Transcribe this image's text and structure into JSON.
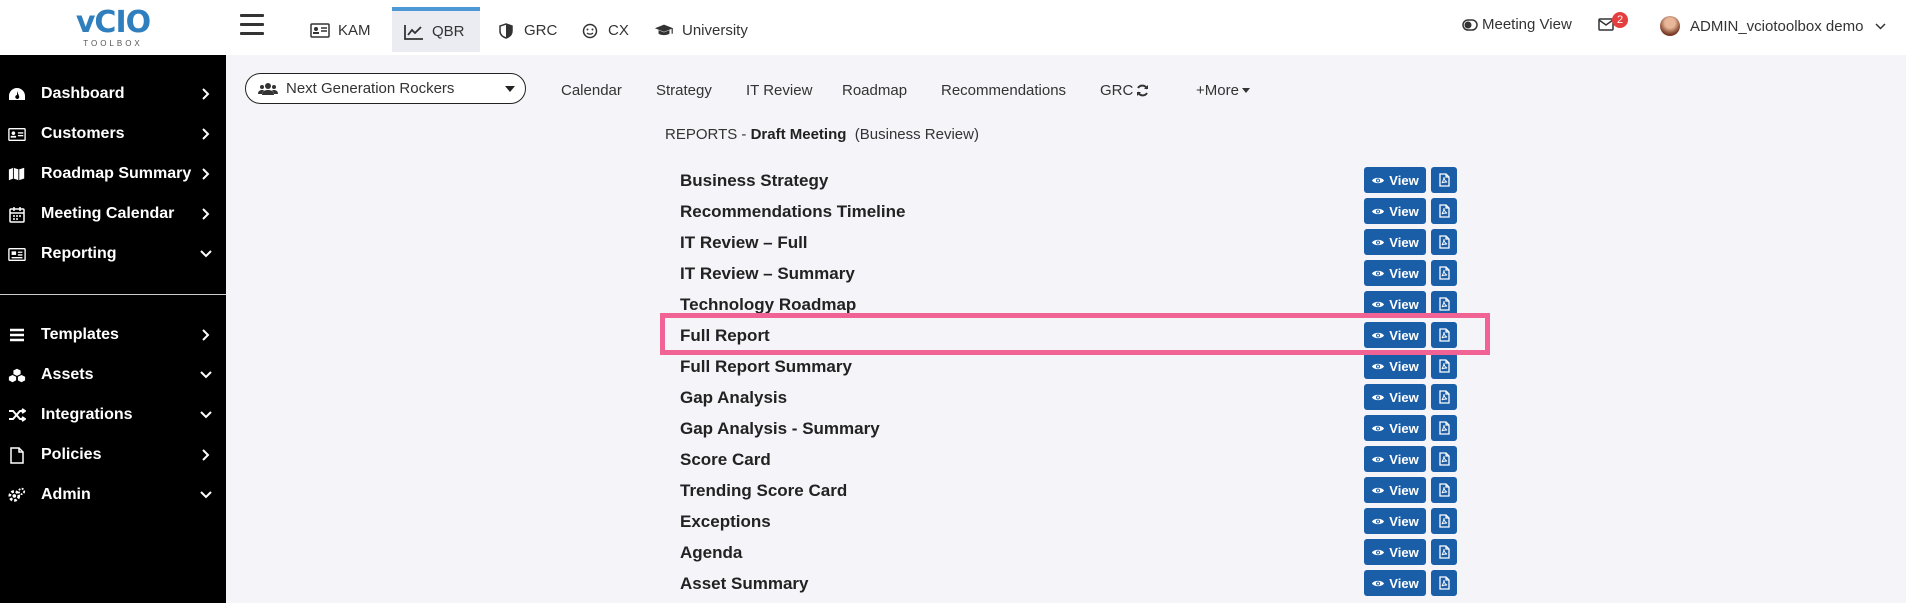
{
  "logo": {
    "text": "vCIO",
    "subtext": "TOOLBOX"
  },
  "sidebar": {
    "items": [
      {
        "label": "Dashboard",
        "icon": "dashboard-icon",
        "arrow": "chevron-right"
      },
      {
        "label": "Customers",
        "icon": "address-card-icon",
        "arrow": "chevron-right"
      },
      {
        "label": "Roadmap Summary",
        "icon": "map-icon",
        "arrow": "chevron-right"
      },
      {
        "label": "Meeting Calendar",
        "icon": "calendar-icon",
        "arrow": "chevron-right"
      },
      {
        "label": "Reporting",
        "icon": "newspaper-icon",
        "arrow": "chevron-down"
      }
    ],
    "items2": [
      {
        "label": "Templates",
        "icon": "bars-icon",
        "arrow": "chevron-right"
      },
      {
        "label": "Assets",
        "icon": "cubes-icon",
        "arrow": "chevron-down"
      },
      {
        "label": "Integrations",
        "icon": "random-icon",
        "arrow": "chevron-down"
      },
      {
        "label": "Policies",
        "icon": "file-icon",
        "arrow": "chevron-right"
      },
      {
        "label": "Admin",
        "icon": "cogs-icon",
        "arrow": "chevron-down"
      }
    ]
  },
  "topbar": {
    "tabs": [
      {
        "label": "KAM",
        "icon": "id-card-icon"
      },
      {
        "label": "QBR",
        "icon": "chart-line-icon"
      },
      {
        "label": "GRC",
        "icon": "shield-icon"
      },
      {
        "label": "CX",
        "icon": "smile-icon"
      },
      {
        "label": "University",
        "icon": "graduation-cap-icon"
      }
    ],
    "active_tab": "QBR",
    "meeting_view": "Meeting View",
    "mail_badge": "2",
    "user": "ADMIN_vciotoolbox demo"
  },
  "subnav": {
    "customer": "Next Generation Rockers",
    "links": [
      "Calendar",
      "Strategy",
      "IT Review",
      "Roadmap",
      "Recommendations",
      "GRC",
      "+More"
    ]
  },
  "breadcrumb": {
    "prefix": "REPORTS - ",
    "meeting": "Draft Meeting",
    "type": "(Business Review)"
  },
  "reports": {
    "view_label": "View",
    "items": [
      "Business Strategy",
      "Recommendations Timeline",
      "IT Review – Full",
      "IT Review – Summary",
      "Technology Roadmap",
      "Full Report",
      "Full Report Summary",
      "Gap Analysis",
      "Gap Analysis - Summary",
      "Score Card",
      "Trending Score Card",
      "Exceptions",
      "Agenda",
      "Asset Summary"
    ],
    "highlighted": "Full Report"
  },
  "colors": {
    "sidebar_bg": "#000000",
    "button_blue": "#1a5ea8",
    "highlight": "#f06394",
    "active_tab_border": "#4d99d6",
    "badge": "#e53e3e"
  }
}
